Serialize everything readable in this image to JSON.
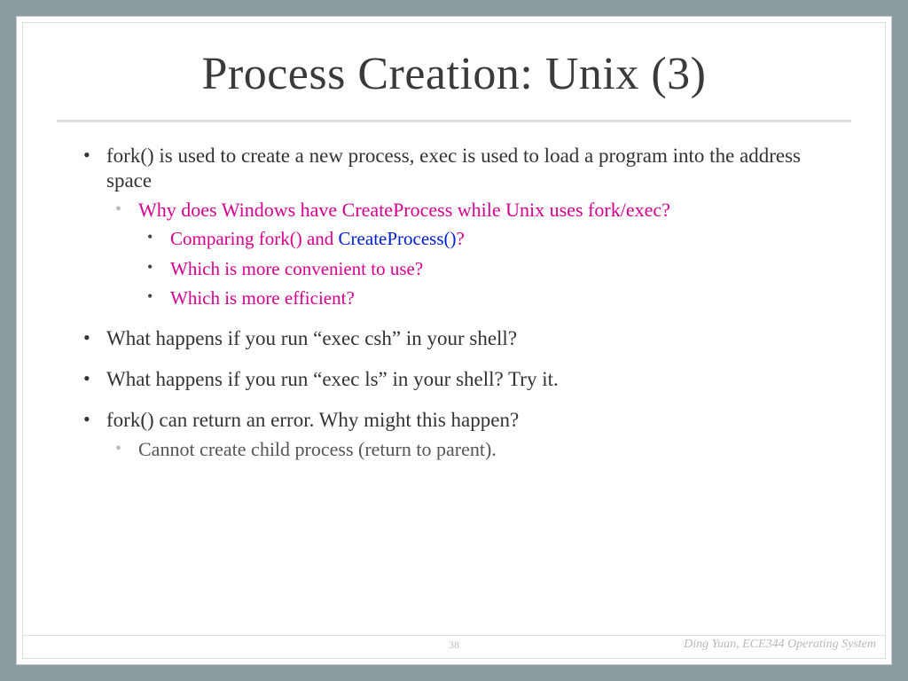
{
  "title": "Process Creation: Unix (3)",
  "bullets": {
    "b1": "fork() is used to create a new process, exec is used to load a program into the address space",
    "b1_sub1": "Why does Windows have CreateProcess while Unix uses fork/exec?",
    "b1_sub1_a_pre": "Comparing fork() and ",
    "b1_sub1_a_link": "CreateProcess()",
    "b1_sub1_a_post": "?",
    "b1_sub1_b": "Which is more convenient to use?",
    "b1_sub1_c": "Which is more efficient?",
    "b2": "What happens if you run “exec csh” in your shell?",
    "b3": "What happens if you run “exec ls” in your shell? Try it.",
    "b4": "fork() can return an error.  Why might this happen?",
    "b4_sub1": "Cannot create child process (return to parent)."
  },
  "footer": {
    "page": "38",
    "author": "Ding Yuan, ECE344 Operating System"
  }
}
